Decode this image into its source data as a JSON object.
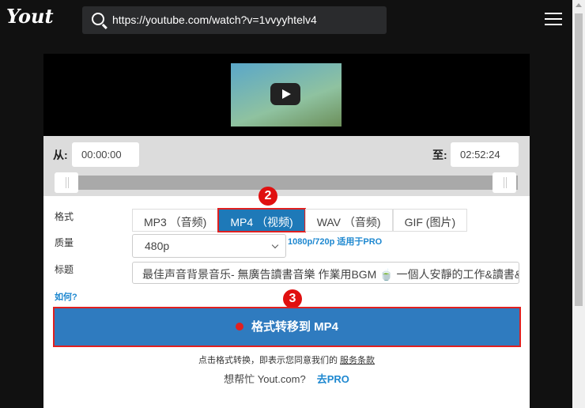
{
  "header": {
    "logo": "Yout",
    "url": "https://youtube.com/watch?v=1vvyyhtelv4"
  },
  "trim": {
    "from_label": "从:",
    "from_value": "00:00:00",
    "to_label": "至:",
    "to_value": "02:52:24"
  },
  "form": {
    "format_label": "格式",
    "formats": [
      "MP3 （音频)",
      "MP4 （视频)",
      "WAV （音频)",
      "GIF (图片)"
    ],
    "selected_format": "MP4 （视频)",
    "quality_label": "质量",
    "quality_value": "480p",
    "pro_note": "1080p/720p 适用于PRO",
    "title_label": "标题",
    "title_value": "最佳声音背景音乐- 無廣告讀書音樂 作業用BGM 🍵 一個人安靜的工作&讀書&",
    "how_link": "如何?",
    "convert_label": "格式转移到 MP4"
  },
  "annotations": {
    "step2": "2",
    "step3": "3"
  },
  "footer": {
    "terms_text": "点击格式转换，即表示您同意我们的",
    "terms_link": "服务条款",
    "help_text": "想帮忙 Yout.com?",
    "pro_link": "去PRO"
  },
  "colors": {
    "accent": "#2f7bbf",
    "highlight": "#e02020"
  }
}
